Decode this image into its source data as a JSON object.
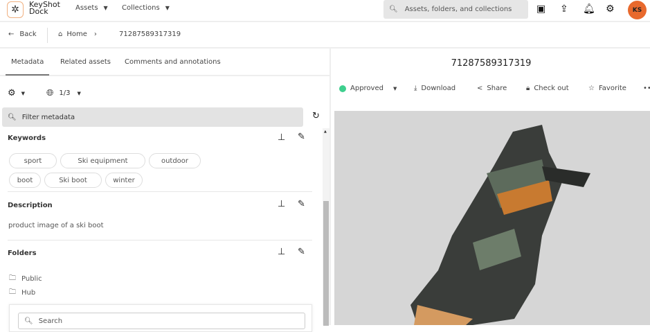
{
  "app": {
    "name_line1": "KeyShot",
    "name_line2": "Dock",
    "nav": [
      {
        "label": "Assets"
      },
      {
        "label": "Collections"
      }
    ],
    "search_placeholder": "Assets, folders, and collections",
    "avatar": "KS",
    "avatar_color": "#e8692d"
  },
  "breadcrumb": {
    "back": "Back",
    "home": "Home",
    "current": "71287589317319"
  },
  "tabs": [
    {
      "label": "Metadata"
    },
    {
      "label": "Related assets"
    },
    {
      "label": "Comments and annotations"
    }
  ],
  "toolbar": {
    "language_count": "1/3",
    "filter_placeholder": "Filter metadata"
  },
  "keywords": {
    "title": "Keywords",
    "items": [
      "sport",
      "Ski equipment",
      "outdoor",
      "boot",
      "Ski boot",
      "winter"
    ]
  },
  "description": {
    "title": "Description",
    "text": "product image of a ski boot"
  },
  "folders": {
    "title": "Folders",
    "items": [
      "Public",
      "Hub"
    ],
    "search_placeholder": "Search"
  },
  "asset": {
    "title": "71287589317319",
    "status": "Approved",
    "status_color": "#3ecf8e",
    "actions": [
      "Download",
      "Share",
      "Check out",
      "Favorite"
    ]
  }
}
